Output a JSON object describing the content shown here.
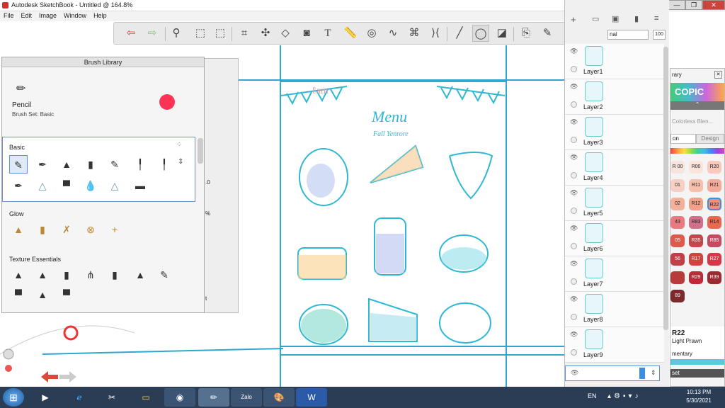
{
  "window": {
    "title": "Autodesk SketchBook - Untitled @ 164.8%",
    "min": "—",
    "max": "❐",
    "close": "✕"
  },
  "menu": [
    "File",
    "Edit",
    "Image",
    "Window",
    "Help"
  ],
  "canvas": {
    "menu_title": "Menu",
    "menu_subtitle": "Fall Yenrore"
  },
  "brush_library": {
    "title": "Brush Library",
    "selected_name": "Pencil",
    "brush_set": "Brush Set: Basic",
    "sections": [
      "Basic",
      "Glow",
      "Texture Essentials"
    ]
  },
  "behind_panel": {
    "v1": ".0",
    "v2": "%",
    "v3": "t"
  },
  "layer_panel": {
    "blend_mode": "nal",
    "opacity": "100",
    "layers": [
      "Layer1",
      "Layer2",
      "Layer3",
      "Layer4",
      "Layer5",
      "Layer6",
      "Layer7",
      "Layer8",
      "Layer9"
    ]
  },
  "copic": {
    "title": "rary",
    "logo": "COPIC",
    "search": "Colorless Blen...",
    "tabs": [
      "on",
      "Design"
    ],
    "swatch_labels": [
      "R\n00",
      "R00",
      "R20",
      "01",
      "R11",
      "R21",
      "02",
      "R12",
      "R22",
      "43",
      "R83",
      "R14",
      "05",
      "R35",
      "R85",
      "56",
      "R17",
      "R27",
      "",
      "R29",
      "R39",
      "89"
    ],
    "color_code": "R22",
    "color_name": "Light Prawn",
    "category": "mentary",
    "reset": "set"
  },
  "taskbar": {
    "lang": "EN",
    "time": "10:13 PM",
    "date": "5/30/2021",
    "zalo": "Zalo"
  }
}
